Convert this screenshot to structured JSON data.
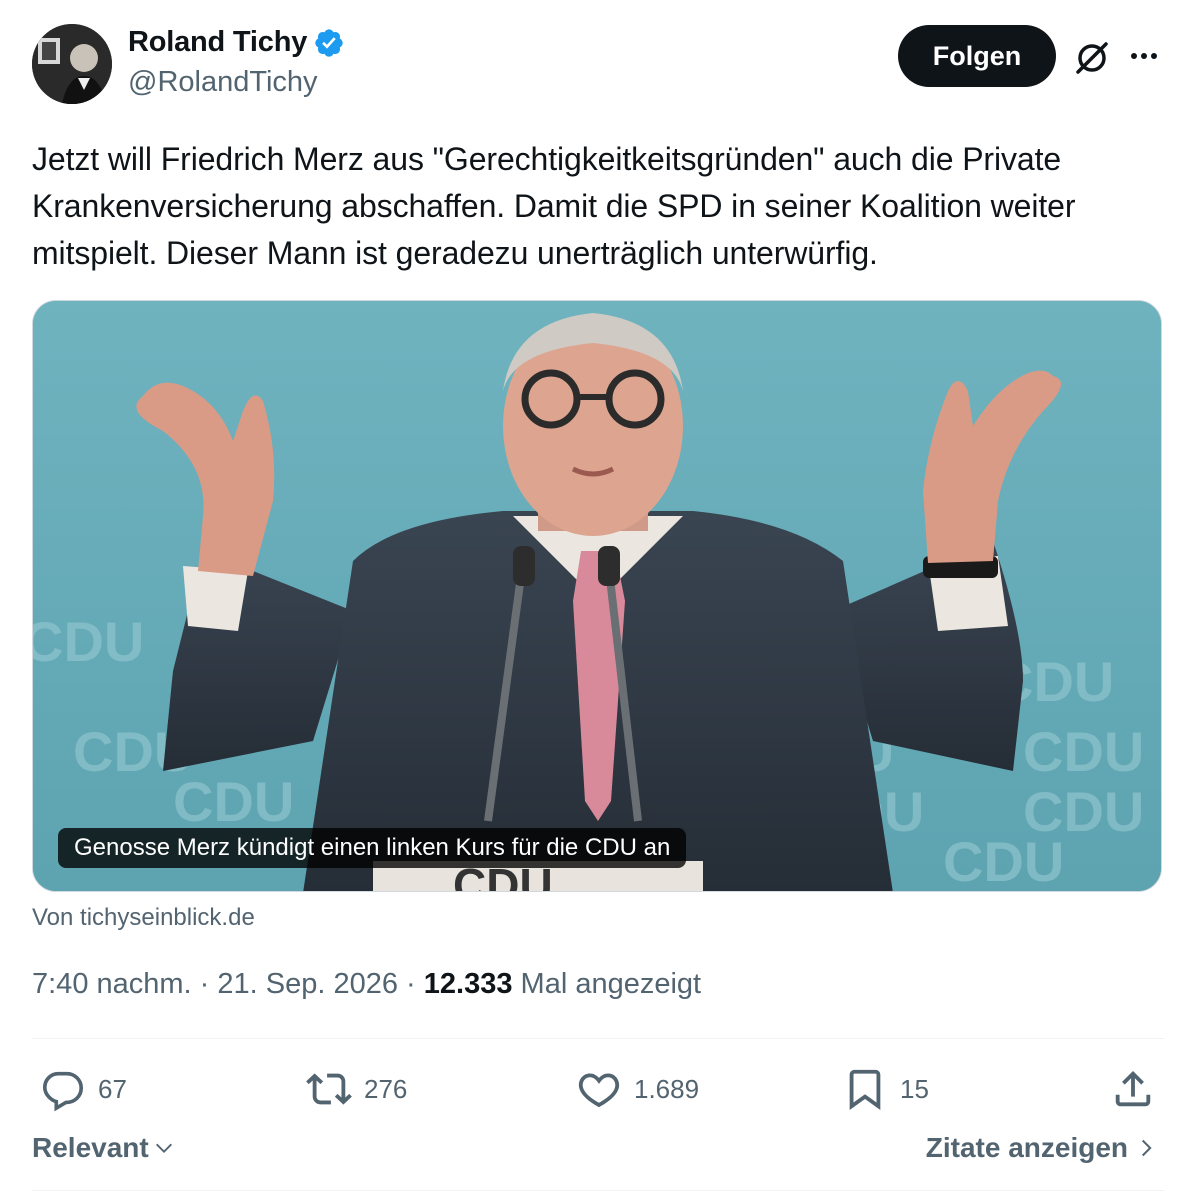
{
  "author": {
    "name": "Roland Tichy",
    "handle": "@RolandTichy",
    "verified_color": "#1d9bf0"
  },
  "follow_label": "Folgen",
  "tweet": {
    "text": "Jetzt will Friedrich Merz aus \"Gerechtigkeitkeitsgründen\" auch die Private Krankenversicherung abschaffen. Damit die SPD in seiner Koalition weiter mitspielt. Dieser Mann ist geradezu unerträglich unterwürfig."
  },
  "media": {
    "caption": "Genosse Merz kündigt einen linken Kurs für die CDU an",
    "source": "Von tichyseinblick.de",
    "backdrop_text": "CDU"
  },
  "meta": {
    "time": "7:40 nachm.",
    "date": "21. Sep. 2026",
    "views": "12.333",
    "views_label": "Mal angezeigt"
  },
  "actions": {
    "replies": "67",
    "reposts": "276",
    "likes": "1.689",
    "bookmarks": "15"
  },
  "footer": {
    "sort_label": "Relevant",
    "quotes_label": "Zitate anzeigen"
  },
  "colors": {
    "text": "#0f1419",
    "secondary": "#536471",
    "button_bg": "#0f1419",
    "backdrop": "#6aacb8"
  }
}
